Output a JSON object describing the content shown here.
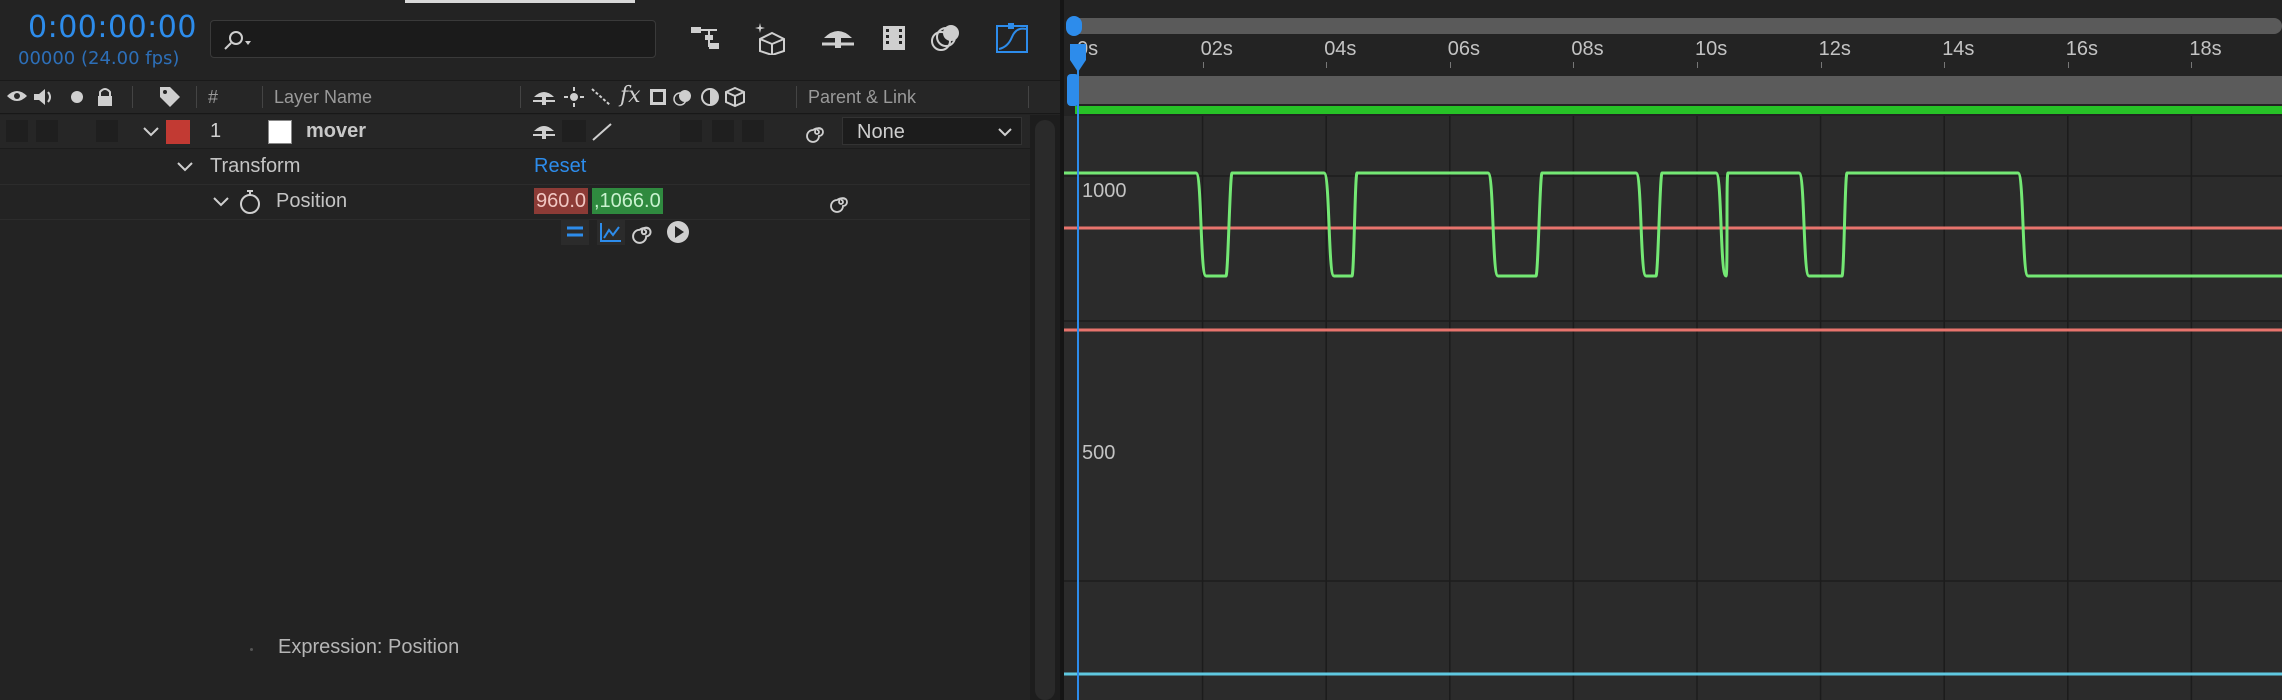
{
  "composition": {
    "timecode": "0:00:00:00",
    "frame_fps": "00000 (24.00 fps)",
    "search_placeholder": ""
  },
  "toolbar": {
    "icons": [
      "composition-flowchart-icon",
      "draft-3d-icon",
      "shy-icon",
      "frame-blending-icon",
      "motion-blur-icon",
      "graph-editor-icon"
    ]
  },
  "columns": {
    "num": "#",
    "layer_name": "Layer Name",
    "parent_link": "Parent & Link"
  },
  "layer": {
    "number": "1",
    "name": "mover",
    "label_color": "#c23a33",
    "parent": "None"
  },
  "transform": {
    "label": "Transform",
    "reset": "Reset",
    "position": {
      "label": "Position",
      "x": "960.0",
      "y": ",1066.0"
    }
  },
  "expression": {
    "label": "Expression: Position"
  },
  "graph": {
    "time_ticks": [
      "0s",
      "02s",
      "04s",
      "06s",
      "08s",
      "10s",
      "12s",
      "14s",
      "16s",
      "18s"
    ],
    "time_tick_seconds": [
      0,
      2,
      4,
      6,
      8,
      10,
      12,
      14,
      16,
      18
    ],
    "value_labels": [
      "1000",
      "500"
    ],
    "colors": {
      "x_curve": "#e8746d",
      "y_curve": "#74e874",
      "playhead": "#2d8ceb",
      "cache": "#27c227"
    }
  }
}
